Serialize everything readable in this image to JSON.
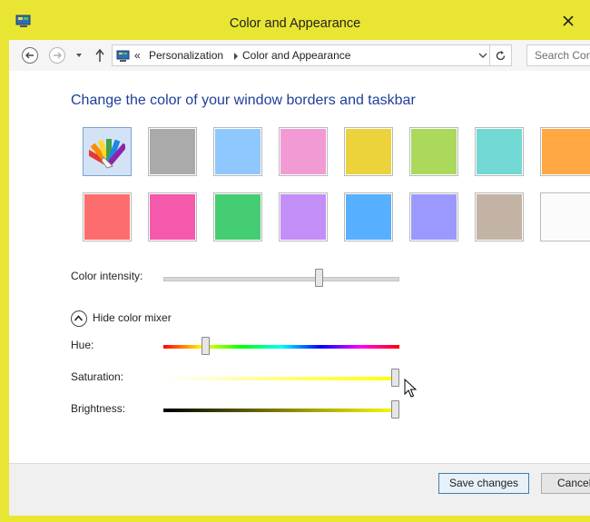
{
  "window": {
    "title": "Color and Appearance"
  },
  "address_bar": {
    "overflow": "«",
    "crumbs": [
      "Personalization",
      "Color and Appearance"
    ],
    "search_placeholder": "Search Con"
  },
  "heading": "Change the color of your window borders and taskbar",
  "swatches": {
    "row1": [
      {
        "name": "automatic",
        "color": "#3a8de0",
        "selected": true,
        "icon": "color-fan-icon"
      },
      {
        "name": "gray",
        "color": "#aaaaaa"
      },
      {
        "name": "light-blue",
        "color": "#8ec8ff"
      },
      {
        "name": "pink",
        "color": "#f29ad4"
      },
      {
        "name": "yellow",
        "color": "#ecd23b"
      },
      {
        "name": "lime",
        "color": "#aad95c"
      },
      {
        "name": "teal",
        "color": "#72d8d4"
      },
      {
        "name": "orange",
        "color": "#ffa844"
      }
    ],
    "row2": [
      {
        "name": "red",
        "color": "#fd6d6d"
      },
      {
        "name": "magenta",
        "color": "#f459ab"
      },
      {
        "name": "green",
        "color": "#45cd73"
      },
      {
        "name": "violet",
        "color": "#c38ef7"
      },
      {
        "name": "blue",
        "color": "#56afff"
      },
      {
        "name": "periwinkle",
        "color": "#9c99fe"
      },
      {
        "name": "tan",
        "color": "#c2b3a5"
      },
      {
        "name": "white",
        "color": "#fbfbfb"
      }
    ]
  },
  "intensity": {
    "label": "Color intensity:",
    "level": 0.67
  },
  "mixer": {
    "toggle_label": "Hide color mixer",
    "hue": {
      "label": "Hue:",
      "level": 0.18
    },
    "saturation": {
      "label": "Saturation:",
      "level": 1.0
    },
    "brightness": {
      "label": "Brightness:",
      "level": 1.0
    }
  },
  "buttons": {
    "save": "Save changes",
    "cancel": "Cancel"
  },
  "colors": {
    "window_frame": "#e8e632",
    "heading_text": "#1e3f9a",
    "accent_tint": "#e8e632"
  }
}
